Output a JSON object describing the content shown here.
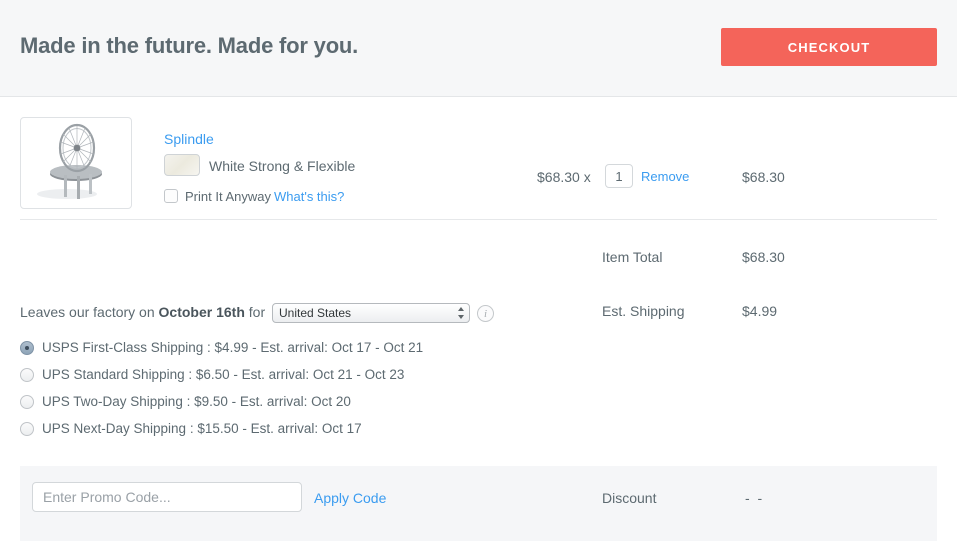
{
  "header": {
    "title": "Made in the future. Made for you.",
    "checkout_label": "CHECKOUT",
    "accent_color": "#f4645a",
    "background_color": "#f6f7f8"
  },
  "cart": {
    "item": {
      "name": "Splindle",
      "thumbnail_alt": "splindle-3d-print-thumbnail",
      "material": "White Strong & Flexible",
      "material_swatch_color": "#efeee4",
      "print_it_anyway_label": "Print It Anyway",
      "print_it_anyway_help": "What's this?",
      "print_it_anyway_checked": false,
      "unit_price": "$68.30 x",
      "quantity": "1",
      "remove_label": "Remove",
      "line_total": "$68.30"
    },
    "totals": [
      {
        "label": "Item Total",
        "value": "$68.30"
      },
      {
        "label": "Est. Shipping",
        "value": "$4.99"
      }
    ]
  },
  "shipping": {
    "factory_prefix": "Leaves our factory on ",
    "factory_date": "October 16th",
    "factory_suffix": " for",
    "country_selected": "United States",
    "country_options": [
      "United States"
    ],
    "info_icon_glyph": "i",
    "options": [
      {
        "label": "USPS First-Class Shipping : $4.99 - Est. arrival: Oct 17 - Oct 21",
        "selected": true
      },
      {
        "label": "UPS Standard Shipping : $6.50 - Est. arrival: Oct 21 - Oct 23",
        "selected": false
      },
      {
        "label": "UPS Two-Day Shipping : $9.50 - Est. arrival: Oct 20",
        "selected": false
      },
      {
        "label": "UPS Next-Day Shipping : $15.50 - Est. arrival: Oct 17",
        "selected": false
      }
    ]
  },
  "promo": {
    "placeholder": "Enter Promo Code...",
    "value": "",
    "apply_label": "Apply Code",
    "discount_label": "Discount",
    "discount_value": "- -"
  }
}
